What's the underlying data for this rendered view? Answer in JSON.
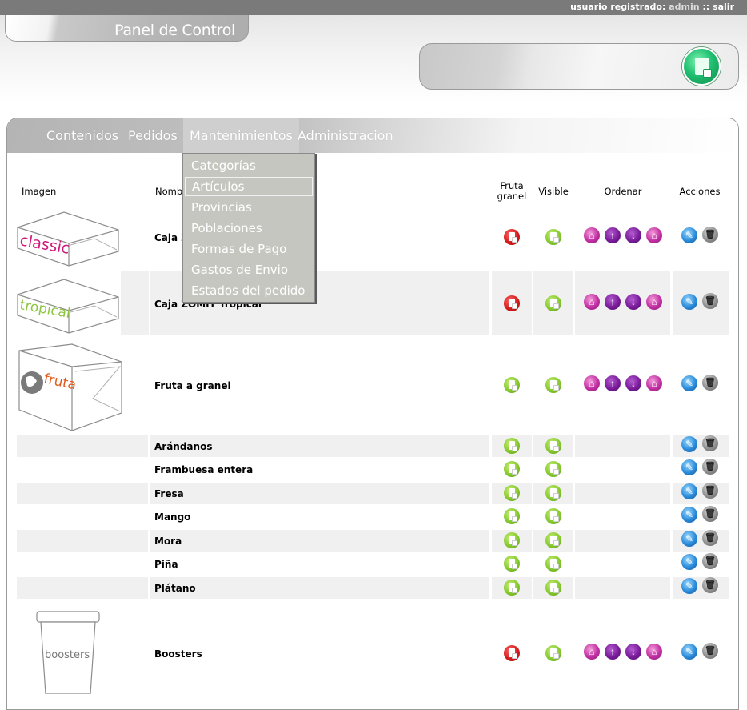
{
  "topbar": {
    "user_prefix": "usuario registrado:",
    "user_name": "admin",
    "separator": "::",
    "logout": "salir"
  },
  "header": {
    "title": "Panel de Control"
  },
  "nav": {
    "items": [
      {
        "label": "Contenidos"
      },
      {
        "label": "Pedidos"
      },
      {
        "label": "Mantenimientos"
      },
      {
        "label": "Administracion"
      }
    ],
    "active": "Mantenimientos"
  },
  "dropdown": {
    "items": [
      {
        "label": "Categorías"
      },
      {
        "label": "Artículos"
      },
      {
        "label": "Provincias"
      },
      {
        "label": "Poblaciones"
      },
      {
        "label": "Formas de Pago"
      },
      {
        "label": "Gastos de Envio"
      },
      {
        "label": "Estados del pedido"
      }
    ],
    "hovered": "Artículos"
  },
  "table": {
    "headers": {
      "image": "Imagen",
      "name": "Nomb",
      "bulk_line1": "Fruta",
      "bulk_line2": "granel",
      "visible": "Visible",
      "order": "Ordenar",
      "actions": "Acciones"
    },
    "rows": [
      {
        "name": "Caja Z",
        "image_text": "classic",
        "fruta_granel": "no",
        "visible": "yes"
      },
      {
        "name": "Caja ZOMIT Tropical",
        "image_text": "tropical",
        "fruta_granel": "no",
        "visible": "yes"
      },
      {
        "name": "Fruta a granel",
        "image_text": "fruta",
        "fruta_granel": "yes",
        "visible": "yes"
      },
      {
        "name": "Arándanos",
        "fruta_granel": "yes",
        "visible": "yes"
      },
      {
        "name": "Frambuesa entera",
        "fruta_granel": "yes",
        "visible": "yes"
      },
      {
        "name": "Fresa",
        "fruta_granel": "yes",
        "visible": "yes"
      },
      {
        "name": "Mango",
        "fruta_granel": "yes",
        "visible": "yes"
      },
      {
        "name": "Mora",
        "fruta_granel": "yes",
        "visible": "yes"
      },
      {
        "name": "Piña",
        "fruta_granel": "yes",
        "visible": "yes"
      },
      {
        "name": "Plátano",
        "fruta_granel": "yes",
        "visible": "yes"
      },
      {
        "name": "Boosters",
        "image_text": "boosters",
        "fruta_granel": "no",
        "visible": "yes"
      }
    ]
  },
  "icons": {
    "status_button": "document-arrow-icon",
    "not_bulk": "red-document-icon",
    "bulk": "green-document-icon",
    "visible": "green-document-icon",
    "order_first": "move-first-icon",
    "order_up": "move-up-icon",
    "order_down": "move-down-icon",
    "order_last": "move-last-icon",
    "edit": "edit-pencil-icon",
    "delete": "trash-icon"
  },
  "colors": {
    "topbar": "#7a7a7a",
    "not_bulk_red": "#d41c1c",
    "yes_green": "#86c92e",
    "order_pink": "#c12fa2",
    "order_purple": "#7a1c9a",
    "edit_blue": "#2a8ad9",
    "delete_gray": "#8f8f8f",
    "stripe": "#f0f0f0",
    "dropdown_bg": "#c6c6c0"
  }
}
